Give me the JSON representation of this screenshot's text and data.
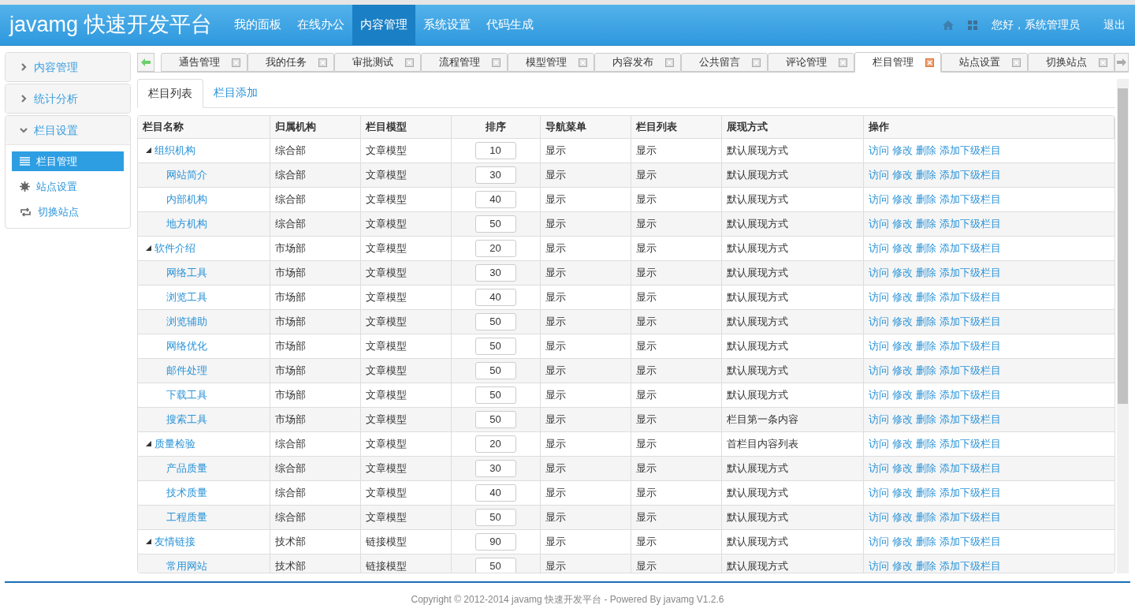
{
  "header": {
    "logo": "javamg 快速开发平台",
    "nav": [
      {
        "label": "我的面板",
        "selected": false
      },
      {
        "label": "在线办公",
        "selected": false
      },
      {
        "label": "内容管理",
        "selected": true
      },
      {
        "label": "系统设置",
        "selected": false
      },
      {
        "label": "代码生成",
        "selected": false
      }
    ],
    "greeting": "您好，系统管理员",
    "logout": "退出"
  },
  "sidebar": {
    "groups": [
      {
        "title": "内容管理",
        "expanded": false
      },
      {
        "title": "统计分析",
        "expanded": false
      },
      {
        "title": "栏目设置",
        "expanded": true,
        "items": [
          {
            "label": "栏目管理",
            "kind": "list",
            "selected": true
          },
          {
            "label": "站点设置",
            "kind": "gear",
            "selected": false
          },
          {
            "label": "切换站点",
            "kind": "swap",
            "selected": false
          }
        ]
      }
    ]
  },
  "tabs": [
    {
      "label": "通告管理",
      "selected": false
    },
    {
      "label": "我的任务",
      "selected": false
    },
    {
      "label": "审批测试",
      "selected": false
    },
    {
      "label": "流程管理",
      "selected": false
    },
    {
      "label": "模型管理",
      "selected": false
    },
    {
      "label": "内容发布",
      "selected": false
    },
    {
      "label": "公共留言",
      "selected": false
    },
    {
      "label": "评论管理",
      "selected": false
    },
    {
      "label": "栏目管理",
      "selected": true
    },
    {
      "label": "站点设置",
      "selected": false
    },
    {
      "label": "切换站点",
      "selected": false
    }
  ],
  "subtabs": [
    {
      "label": "栏目列表",
      "selected": true
    },
    {
      "label": "栏目添加",
      "selected": false
    }
  ],
  "table": {
    "columns": [
      "栏目名称",
      "归属机构",
      "栏目模型",
      "排序",
      "导航菜单",
      "栏目列表",
      "展现方式",
      "操作"
    ],
    "rows": [
      {
        "name": "组织机构",
        "org": "综合部",
        "model": "文章模型",
        "sort": "10",
        "nav": "显示",
        "list": "显示",
        "display": "默认展现方式",
        "actions": [
          "访问",
          "修改",
          "删除",
          "添加下级栏目"
        ],
        "expanded": true,
        "children": [
          {
            "name": "网站简介",
            "org": "综合部",
            "model": "文章模型",
            "sort": "30",
            "nav": "显示",
            "list": "显示",
            "display": "默认展现方式",
            "actions": [
              "访问",
              "修改",
              "删除",
              "添加下级栏目"
            ]
          },
          {
            "name": "内部机构",
            "org": "综合部",
            "model": "文章模型",
            "sort": "40",
            "nav": "显示",
            "list": "显示",
            "display": "默认展现方式",
            "actions": [
              "访问",
              "修改",
              "删除",
              "添加下级栏目"
            ]
          },
          {
            "name": "地方机构",
            "org": "综合部",
            "model": "文章模型",
            "sort": "50",
            "nav": "显示",
            "list": "显示",
            "display": "默认展现方式",
            "actions": [
              "访问",
              "修改",
              "删除",
              "添加下级栏目"
            ]
          }
        ]
      },
      {
        "name": "软件介绍",
        "org": "市场部",
        "model": "文章模型",
        "sort": "20",
        "nav": "显示",
        "list": "显示",
        "display": "默认展现方式",
        "actions": [
          "访问",
          "修改",
          "删除",
          "添加下级栏目"
        ],
        "expanded": true,
        "children": [
          {
            "name": "网络工具",
            "org": "市场部",
            "model": "文章模型",
            "sort": "30",
            "nav": "显示",
            "list": "显示",
            "display": "默认展现方式",
            "actions": [
              "访问",
              "修改",
              "删除",
              "添加下级栏目"
            ]
          },
          {
            "name": "浏览工具",
            "org": "市场部",
            "model": "文章模型",
            "sort": "40",
            "nav": "显示",
            "list": "显示",
            "display": "默认展现方式",
            "actions": [
              "访问",
              "修改",
              "删除",
              "添加下级栏目"
            ]
          },
          {
            "name": "浏览辅助",
            "org": "市场部",
            "model": "文章模型",
            "sort": "50",
            "nav": "显示",
            "list": "显示",
            "display": "默认展现方式",
            "actions": [
              "访问",
              "修改",
              "删除",
              "添加下级栏目"
            ]
          },
          {
            "name": "网络优化",
            "org": "市场部",
            "model": "文章模型",
            "sort": "50",
            "nav": "显示",
            "list": "显示",
            "display": "默认展现方式",
            "actions": [
              "访问",
              "修改",
              "删除",
              "添加下级栏目"
            ]
          },
          {
            "name": "邮件处理",
            "org": "市场部",
            "model": "文章模型",
            "sort": "50",
            "nav": "显示",
            "list": "显示",
            "display": "默认展现方式",
            "actions": [
              "访问",
              "修改",
              "删除",
              "添加下级栏目"
            ]
          },
          {
            "name": "下载工具",
            "org": "市场部",
            "model": "文章模型",
            "sort": "50",
            "nav": "显示",
            "list": "显示",
            "display": "默认展现方式",
            "actions": [
              "访问",
              "修改",
              "删除",
              "添加下级栏目"
            ]
          },
          {
            "name": "搜索工具",
            "org": "市场部",
            "model": "文章模型",
            "sort": "50",
            "nav": "显示",
            "list": "显示",
            "display": "栏目第一条内容",
            "actions": [
              "访问",
              "修改",
              "删除",
              "添加下级栏目"
            ]
          }
        ]
      },
      {
        "name": "质量检验",
        "org": "综合部",
        "model": "文章模型",
        "sort": "20",
        "nav": "显示",
        "list": "显示",
        "display": "首栏目内容列表",
        "actions": [
          "访问",
          "修改",
          "删除",
          "添加下级栏目"
        ],
        "expanded": true,
        "children": [
          {
            "name": "产品质量",
            "org": "综合部",
            "model": "文章模型",
            "sort": "30",
            "nav": "显示",
            "list": "显示",
            "display": "默认展现方式",
            "actions": [
              "访问",
              "修改",
              "删除",
              "添加下级栏目"
            ]
          },
          {
            "name": "技术质量",
            "org": "综合部",
            "model": "文章模型",
            "sort": "40",
            "nav": "显示",
            "list": "显示",
            "display": "默认展现方式",
            "actions": [
              "访问",
              "修改",
              "删除",
              "添加下级栏目"
            ]
          },
          {
            "name": "工程质量",
            "org": "综合部",
            "model": "文章模型",
            "sort": "50",
            "nav": "显示",
            "list": "显示",
            "display": "默认展现方式",
            "actions": [
              "访问",
              "修改",
              "删除",
              "添加下级栏目"
            ]
          }
        ]
      },
      {
        "name": "友情链接",
        "org": "技术部",
        "model": "链接模型",
        "sort": "90",
        "nav": "显示",
        "list": "显示",
        "display": "默认展现方式",
        "actions": [
          "访问",
          "修改",
          "删除",
          "添加下级栏目"
        ],
        "expanded": true,
        "children": [
          {
            "name": "常用网站",
            "org": "技术部",
            "model": "链接模型",
            "sort": "50",
            "nav": "显示",
            "list": "显示",
            "display": "默认展现方式",
            "actions": [
              "访问",
              "修改",
              "删除",
              "添加下级栏目"
            ]
          }
        ]
      }
    ]
  },
  "footer": "Copyright © 2012-2014 javamg 快速开发平台 - Powered By javamg V1.2.6"
}
